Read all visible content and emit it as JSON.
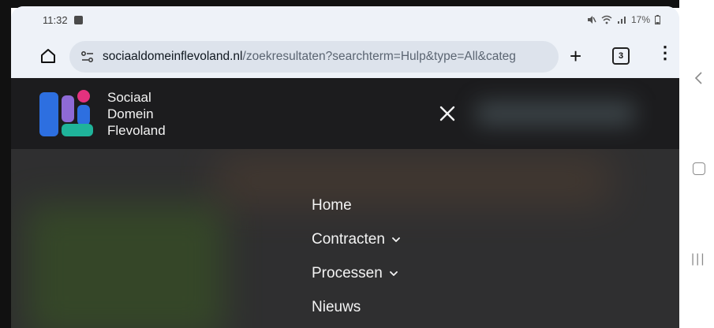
{
  "status_bar": {
    "time": "11:32",
    "battery": "17%",
    "icons": [
      "mail-icon",
      "mute-icon",
      "wifi-icon",
      "signal-icon",
      "battery-icon"
    ]
  },
  "browser": {
    "url_host": "sociaaldomeinflevoland.nl",
    "url_path": "/zoekresultaten?searchterm=Hulp&type=All&categ",
    "tab_count": "3"
  },
  "site": {
    "logo_lines": [
      "Sociaal",
      "Domein",
      "Flevoland"
    ],
    "nav": [
      {
        "label": "Home",
        "has_dropdown": false
      },
      {
        "label": "Contracten",
        "has_dropdown": true
      },
      {
        "label": "Processen",
        "has_dropdown": true
      },
      {
        "label": "Nieuws",
        "has_dropdown": false
      }
    ]
  },
  "colors": {
    "header_bg": "#1c1c1e",
    "overlay_bg": "#2f2f30",
    "logo_blue": "#2d6fe0",
    "logo_purple": "#8e6ad6",
    "logo_pink": "#e4317e",
    "logo_green": "#1fb39a"
  }
}
